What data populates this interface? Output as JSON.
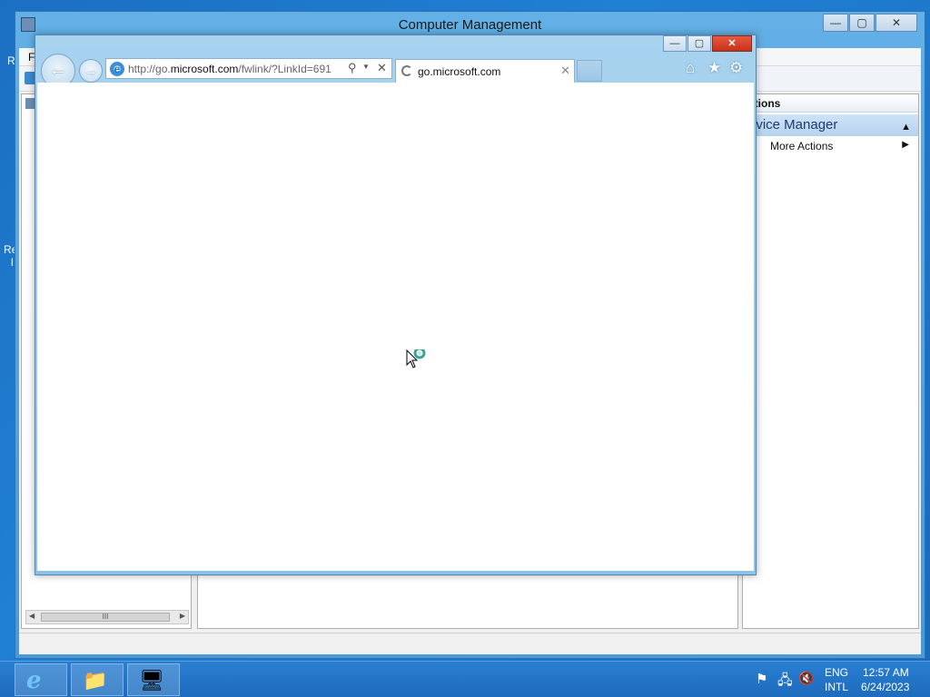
{
  "desktop": {
    "label_r1": "R",
    "label_r2": "Re",
    "label_r3": "l"
  },
  "computer_management": {
    "title": "Computer Management",
    "menu_first_letter": "F",
    "controls": {
      "minimize": "—",
      "maximize": "▢",
      "close": "✕"
    },
    "actions_header": "ctions",
    "actions_subheader": "evice Manager",
    "actions_collapse": "▲",
    "more_actions": "More Actions",
    "more_actions_arrow": "▶",
    "scroll_left": "◀",
    "scroll_right": "▶",
    "scroll_grip": "III"
  },
  "ie": {
    "controls": {
      "minimize": "—",
      "maximize": "▢",
      "close": "✕"
    },
    "back": "←",
    "forward": "→",
    "address_prefix": "http://go.",
    "address_domain": "microsoft.com",
    "address_suffix": "/fwlink/?LinkId=691",
    "search_icon": "⚲",
    "dropdown_icon": "▼",
    "clear_icon": "✕",
    "tab_title": "go.microsoft.com",
    "tab_close": "✕",
    "home_icon": "⌂",
    "favorites_icon": "★",
    "tools_icon": "⚙"
  },
  "taskbar": {
    "ie_icon": "e",
    "explorer_icon": "📁",
    "server_icon": "🖥",
    "flag_icon": "⚑",
    "network_icon": "🖧",
    "volume_icon": "🔇",
    "lang_top": "ENG",
    "lang_bottom": "INTL",
    "time": "12:57 AM",
    "date": "6/24/2023"
  }
}
